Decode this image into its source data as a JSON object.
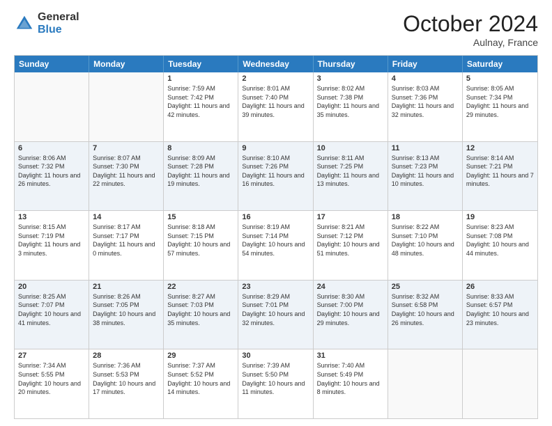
{
  "header": {
    "logo_general": "General",
    "logo_blue": "Blue",
    "month_title": "October 2024",
    "location": "Aulnay, France"
  },
  "days_of_week": [
    "Sunday",
    "Monday",
    "Tuesday",
    "Wednesday",
    "Thursday",
    "Friday",
    "Saturday"
  ],
  "weeks": [
    [
      {
        "day": "",
        "sunrise": "",
        "sunset": "",
        "daylight": ""
      },
      {
        "day": "",
        "sunrise": "",
        "sunset": "",
        "daylight": ""
      },
      {
        "day": "1",
        "sunrise": "Sunrise: 7:59 AM",
        "sunset": "Sunset: 7:42 PM",
        "daylight": "Daylight: 11 hours and 42 minutes."
      },
      {
        "day": "2",
        "sunrise": "Sunrise: 8:01 AM",
        "sunset": "Sunset: 7:40 PM",
        "daylight": "Daylight: 11 hours and 39 minutes."
      },
      {
        "day": "3",
        "sunrise": "Sunrise: 8:02 AM",
        "sunset": "Sunset: 7:38 PM",
        "daylight": "Daylight: 11 hours and 35 minutes."
      },
      {
        "day": "4",
        "sunrise": "Sunrise: 8:03 AM",
        "sunset": "Sunset: 7:36 PM",
        "daylight": "Daylight: 11 hours and 32 minutes."
      },
      {
        "day": "5",
        "sunrise": "Sunrise: 8:05 AM",
        "sunset": "Sunset: 7:34 PM",
        "daylight": "Daylight: 11 hours and 29 minutes."
      }
    ],
    [
      {
        "day": "6",
        "sunrise": "Sunrise: 8:06 AM",
        "sunset": "Sunset: 7:32 PM",
        "daylight": "Daylight: 11 hours and 26 minutes."
      },
      {
        "day": "7",
        "sunrise": "Sunrise: 8:07 AM",
        "sunset": "Sunset: 7:30 PM",
        "daylight": "Daylight: 11 hours and 22 minutes."
      },
      {
        "day": "8",
        "sunrise": "Sunrise: 8:09 AM",
        "sunset": "Sunset: 7:28 PM",
        "daylight": "Daylight: 11 hours and 19 minutes."
      },
      {
        "day": "9",
        "sunrise": "Sunrise: 8:10 AM",
        "sunset": "Sunset: 7:26 PM",
        "daylight": "Daylight: 11 hours and 16 minutes."
      },
      {
        "day": "10",
        "sunrise": "Sunrise: 8:11 AM",
        "sunset": "Sunset: 7:25 PM",
        "daylight": "Daylight: 11 hours and 13 minutes."
      },
      {
        "day": "11",
        "sunrise": "Sunrise: 8:13 AM",
        "sunset": "Sunset: 7:23 PM",
        "daylight": "Daylight: 11 hours and 10 minutes."
      },
      {
        "day": "12",
        "sunrise": "Sunrise: 8:14 AM",
        "sunset": "Sunset: 7:21 PM",
        "daylight": "Daylight: 11 hours and 7 minutes."
      }
    ],
    [
      {
        "day": "13",
        "sunrise": "Sunrise: 8:15 AM",
        "sunset": "Sunset: 7:19 PM",
        "daylight": "Daylight: 11 hours and 3 minutes."
      },
      {
        "day": "14",
        "sunrise": "Sunrise: 8:17 AM",
        "sunset": "Sunset: 7:17 PM",
        "daylight": "Daylight: 11 hours and 0 minutes."
      },
      {
        "day": "15",
        "sunrise": "Sunrise: 8:18 AM",
        "sunset": "Sunset: 7:15 PM",
        "daylight": "Daylight: 10 hours and 57 minutes."
      },
      {
        "day": "16",
        "sunrise": "Sunrise: 8:19 AM",
        "sunset": "Sunset: 7:14 PM",
        "daylight": "Daylight: 10 hours and 54 minutes."
      },
      {
        "day": "17",
        "sunrise": "Sunrise: 8:21 AM",
        "sunset": "Sunset: 7:12 PM",
        "daylight": "Daylight: 10 hours and 51 minutes."
      },
      {
        "day": "18",
        "sunrise": "Sunrise: 8:22 AM",
        "sunset": "Sunset: 7:10 PM",
        "daylight": "Daylight: 10 hours and 48 minutes."
      },
      {
        "day": "19",
        "sunrise": "Sunrise: 8:23 AM",
        "sunset": "Sunset: 7:08 PM",
        "daylight": "Daylight: 10 hours and 44 minutes."
      }
    ],
    [
      {
        "day": "20",
        "sunrise": "Sunrise: 8:25 AM",
        "sunset": "Sunset: 7:07 PM",
        "daylight": "Daylight: 10 hours and 41 minutes."
      },
      {
        "day": "21",
        "sunrise": "Sunrise: 8:26 AM",
        "sunset": "Sunset: 7:05 PM",
        "daylight": "Daylight: 10 hours and 38 minutes."
      },
      {
        "day": "22",
        "sunrise": "Sunrise: 8:27 AM",
        "sunset": "Sunset: 7:03 PM",
        "daylight": "Daylight: 10 hours and 35 minutes."
      },
      {
        "day": "23",
        "sunrise": "Sunrise: 8:29 AM",
        "sunset": "Sunset: 7:01 PM",
        "daylight": "Daylight: 10 hours and 32 minutes."
      },
      {
        "day": "24",
        "sunrise": "Sunrise: 8:30 AM",
        "sunset": "Sunset: 7:00 PM",
        "daylight": "Daylight: 10 hours and 29 minutes."
      },
      {
        "day": "25",
        "sunrise": "Sunrise: 8:32 AM",
        "sunset": "Sunset: 6:58 PM",
        "daylight": "Daylight: 10 hours and 26 minutes."
      },
      {
        "day": "26",
        "sunrise": "Sunrise: 8:33 AM",
        "sunset": "Sunset: 6:57 PM",
        "daylight": "Daylight: 10 hours and 23 minutes."
      }
    ],
    [
      {
        "day": "27",
        "sunrise": "Sunrise: 7:34 AM",
        "sunset": "Sunset: 5:55 PM",
        "daylight": "Daylight: 10 hours and 20 minutes."
      },
      {
        "day": "28",
        "sunrise": "Sunrise: 7:36 AM",
        "sunset": "Sunset: 5:53 PM",
        "daylight": "Daylight: 10 hours and 17 minutes."
      },
      {
        "day": "29",
        "sunrise": "Sunrise: 7:37 AM",
        "sunset": "Sunset: 5:52 PM",
        "daylight": "Daylight: 10 hours and 14 minutes."
      },
      {
        "day": "30",
        "sunrise": "Sunrise: 7:39 AM",
        "sunset": "Sunset: 5:50 PM",
        "daylight": "Daylight: 10 hours and 11 minutes."
      },
      {
        "day": "31",
        "sunrise": "Sunrise: 7:40 AM",
        "sunset": "Sunset: 5:49 PM",
        "daylight": "Daylight: 10 hours and 8 minutes."
      },
      {
        "day": "",
        "sunrise": "",
        "sunset": "",
        "daylight": ""
      },
      {
        "day": "",
        "sunrise": "",
        "sunset": "",
        "daylight": ""
      }
    ]
  ]
}
